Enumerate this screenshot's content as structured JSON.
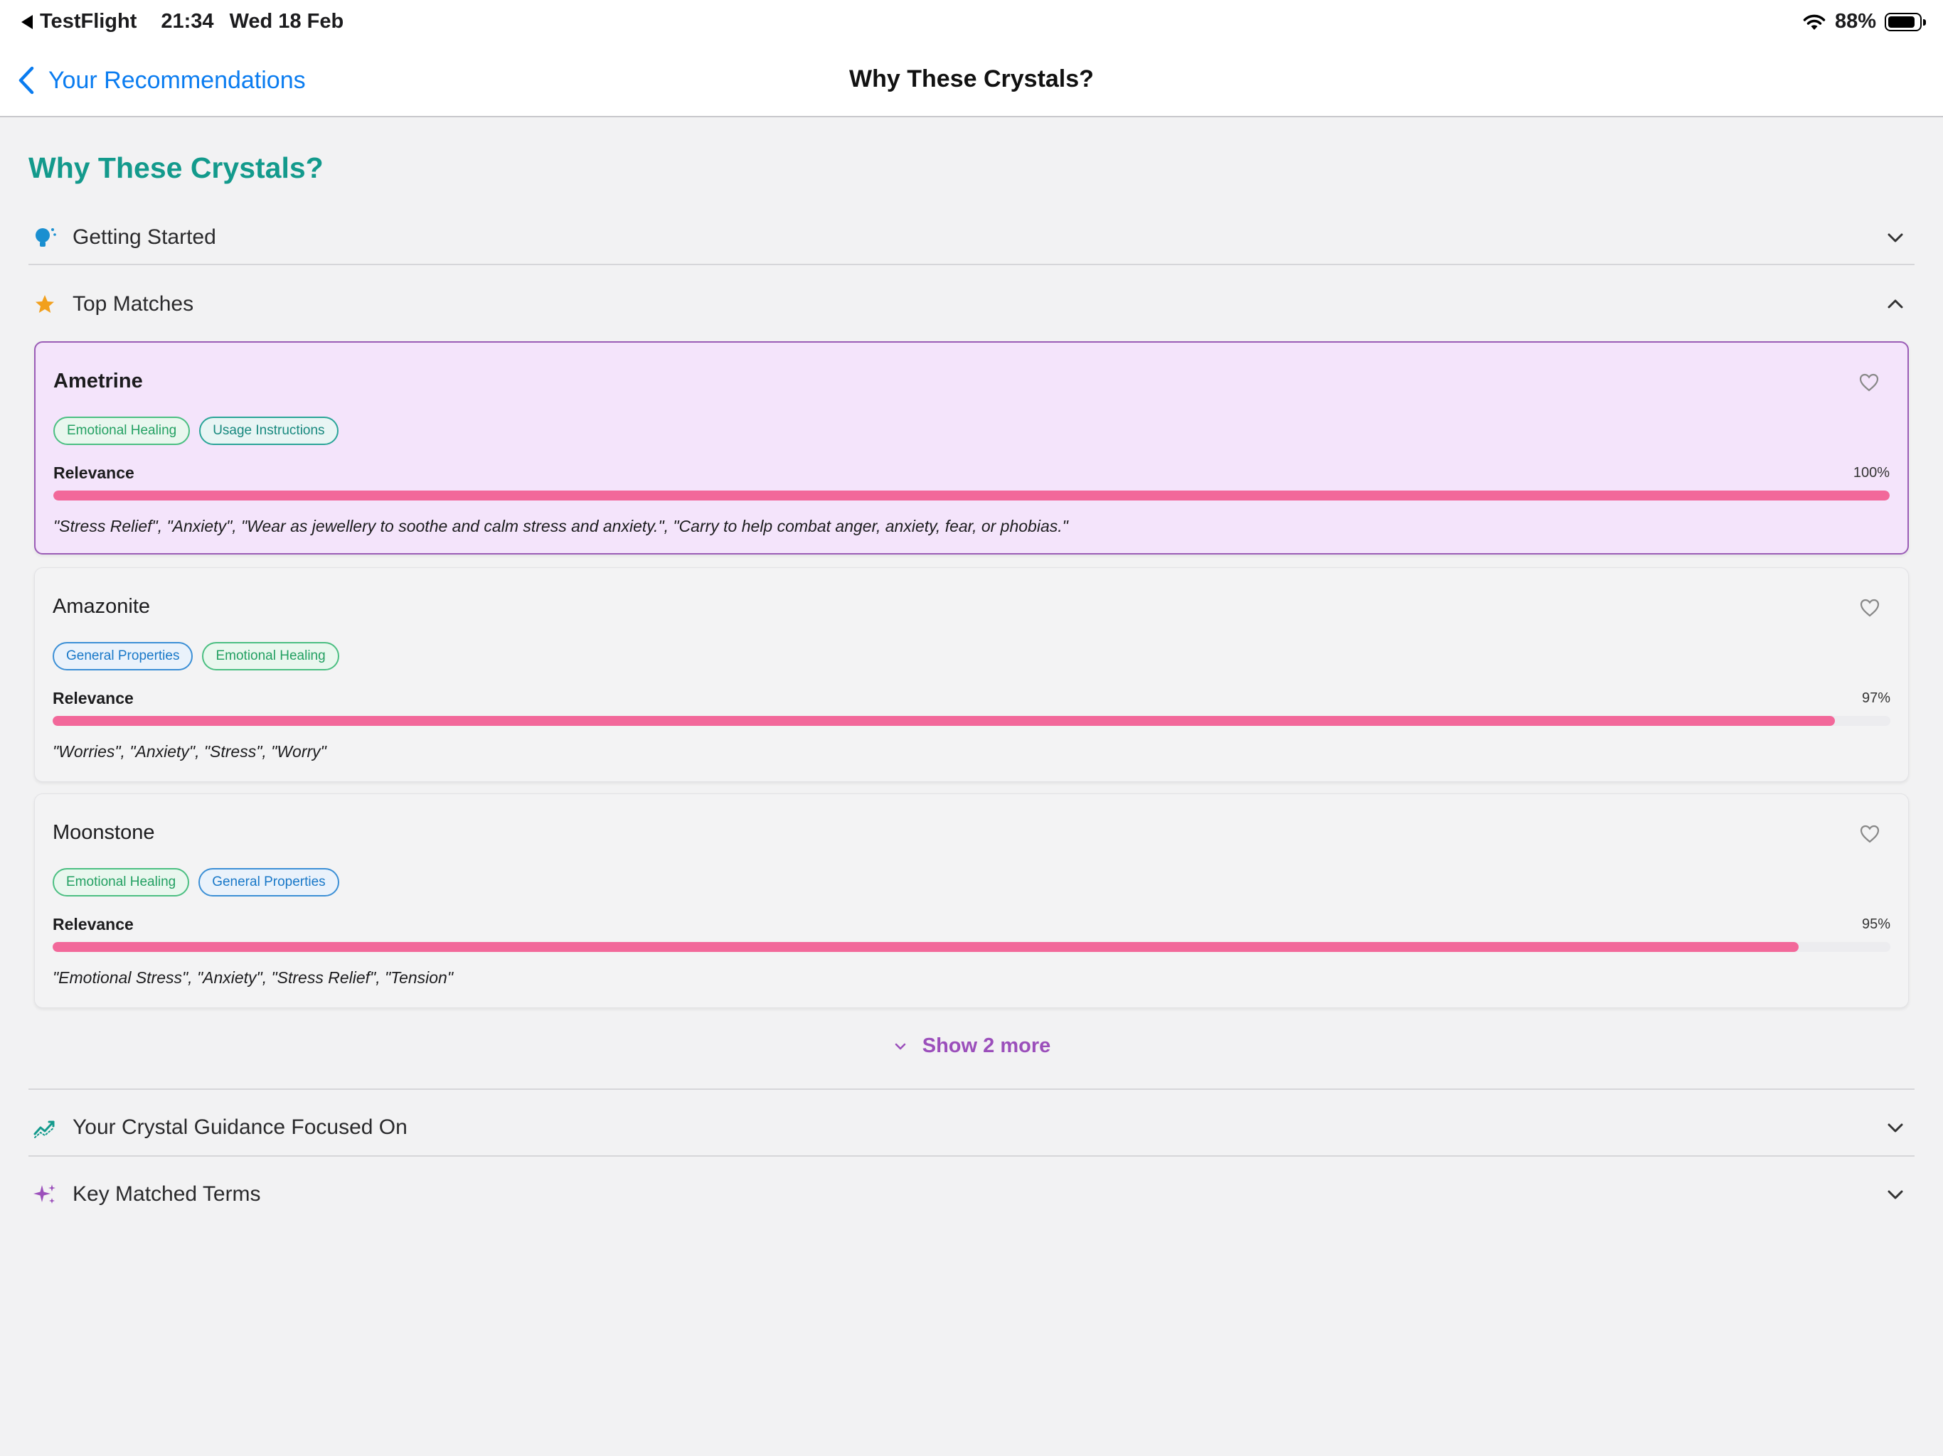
{
  "status_bar": {
    "back_app": "TestFlight",
    "time": "21:34",
    "date": "Wed 18 Feb",
    "battery": "88%",
    "battery_level": 0.88
  },
  "nav": {
    "back_label": "Your Recommendations",
    "title": "Why These Crystals?"
  },
  "page": {
    "heading": "Why These Crystals?"
  },
  "sections": {
    "getting_started": "Getting Started",
    "top_matches": "Top Matches",
    "guidance_focus": "Your Crystal Guidance Focused On",
    "key_terms": "Key Matched Terms"
  },
  "relevance_label": "Relevance",
  "cards": [
    {
      "name": "Ametrine",
      "tags": [
        "Emotional Healing",
        "Usage Instructions"
      ],
      "relevance": "100%",
      "relevance_value": 1.0,
      "quote": "\"Stress Relief\", \"Anxiety\", \"Wear as jewellery to soothe and calm stress and anxiety.\", \"Carry to help combat anger, anxiety, fear, or phobias.\""
    },
    {
      "name": "Amazonite",
      "tags": [
        "General Properties",
        "Emotional Healing"
      ],
      "relevance": "97%",
      "relevance_value": 0.97,
      "quote": "\"Worries\", \"Anxiety\", \"Stress\", \"Worry\""
    },
    {
      "name": "Moonstone",
      "tags": [
        "Emotional Healing",
        "General Properties"
      ],
      "relevance": "95%",
      "relevance_value": 0.95,
      "quote": "\"Emotional Stress\", \"Anxiety\", \"Stress Relief\", \"Tension\""
    }
  ],
  "show_more": "Show 2 more",
  "colors": {
    "accent_teal": "#139a8c",
    "accent_purple": "#9b4fbb",
    "bar_pink": "#f2689a",
    "link_blue": "#0a7cf0"
  }
}
